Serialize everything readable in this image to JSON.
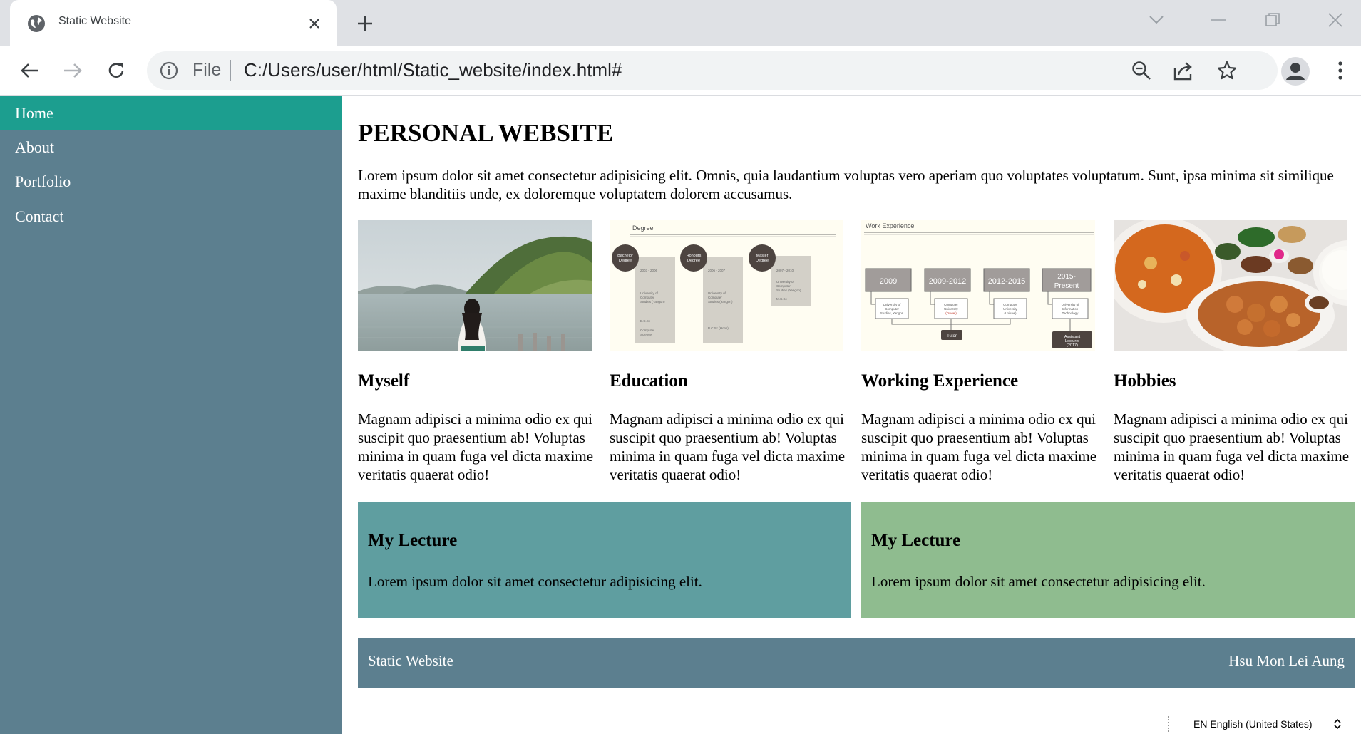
{
  "browser": {
    "tab_title": "Static Website",
    "omnibox_scheme_label": "File",
    "url": "C:/Users/user/html/Static_website/index.html#"
  },
  "sidebar": {
    "items": [
      {
        "label": "Home",
        "active": true
      },
      {
        "label": "About",
        "active": false
      },
      {
        "label": "Portfolio",
        "active": false
      },
      {
        "label": "Contact",
        "active": false
      }
    ]
  },
  "main": {
    "title": "PERSONAL WEBSITE",
    "intro": "Lorem ipsum dolor sit amet consectetur adipisicing elit. Omnis, quia laudantium voluptas vero aperiam quo voluptates voluptatum. Sunt, ipsa minima sit similique maxime blanditiis unde, ex doloremque voluptatem dolorem accusamus.",
    "cards": [
      {
        "title": "Myself",
        "text": "Magnam adipisci a minima odio ex qui suscipit quo praesentium ab! Voluptas minima in quam fuga vel dicta maxime veritatis quaerat odio!"
      },
      {
        "title": "Education",
        "text": "Magnam adipisci a minima odio ex qui suscipit quo praesentium ab! Voluptas minima in quam fuga vel dicta maxime veritatis quaerat odio!"
      },
      {
        "title": "Working Experience",
        "text": "Magnam adipisci a minima odio ex qui suscipit quo praesentium ab! Voluptas minima in quam fuga vel dicta maxime veritatis quaerat odio!"
      },
      {
        "title": "Hobbies",
        "text": "Magnam adipisci a minima odio ex qui suscipit quo praesentium ab! Voluptas minima in quam fuga vel dicta maxime veritatis quaerat odio!"
      }
    ],
    "education_image": {
      "heading": "Degree",
      "items": [
        {
          "badge_line1": "Bachelor",
          "badge_line2": "Degree",
          "years": "2003 - 2006",
          "school": "University of Computer Studies (Yangon)",
          "degree": "B.C.Sc Computer Science"
        },
        {
          "badge_line1": "Honours",
          "badge_line2": "Degree",
          "years": "2006 - 2007",
          "school": "University of Computer Studies (Yangon)",
          "degree": "B.C.Sc (Hons)"
        },
        {
          "badge_line1": "Master",
          "badge_line2": "Degree",
          "years": "2007 - 2010",
          "school": "University of Computer Studies (Yangon)",
          "degree": "M.C.Sc"
        }
      ]
    },
    "work_image": {
      "heading": "Work Experience",
      "items": [
        {
          "year": "2009",
          "place": "University of Computer Studies, Yangon"
        },
        {
          "year": "2009-2012",
          "place": "Computer University (Dawei)"
        },
        {
          "year": "2012-2015",
          "place": "Computer University (Loikaw)"
        },
        {
          "year": "2015-Present",
          "place": "University of Information Technology"
        }
      ],
      "role_tutor": "Tutor",
      "role_lecturer": "Assistant Lecturer (2017)"
    },
    "lectures": [
      {
        "title": "My Lecture",
        "text": "Lorem ipsum dolor sit amet consectetur adipisicing elit.",
        "color": "#5f9ea0"
      },
      {
        "title": "My Lecture",
        "text": "Lorem ipsum dolor sit amet consectetur adipisicing elit.",
        "color": "#8fbc8f"
      }
    ],
    "footer": {
      "left": "Static Website",
      "right": "Hsu Mon Lei Aung"
    }
  },
  "taskbar": {
    "language": "EN English (United States)"
  },
  "colors": {
    "sidebar": "#5c7f8f",
    "active_nav": "#1c9e8f",
    "footer": "#5c7f8f",
    "chrome_bg": "#dfe1e5"
  }
}
